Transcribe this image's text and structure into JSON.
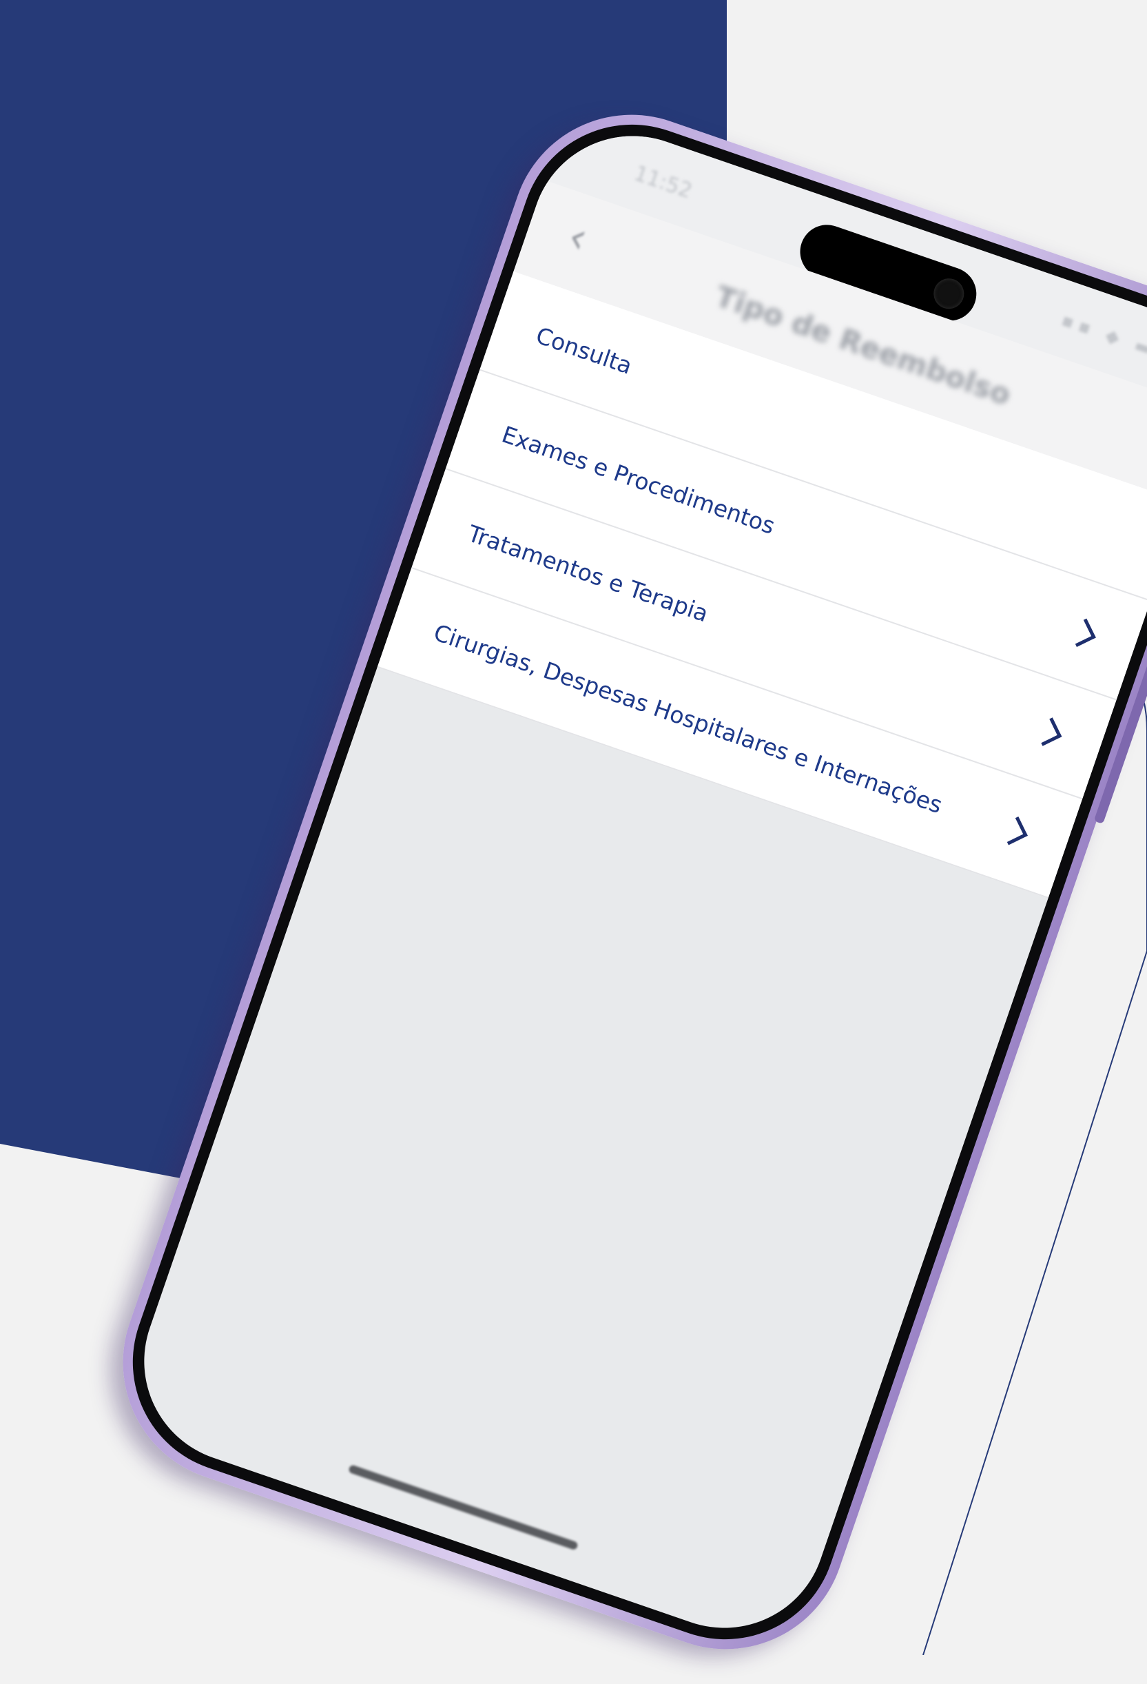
{
  "screen": {
    "status_time": "11:52",
    "status_icons": "▪▪ ◆ ▬",
    "nav": {
      "back_icon": "‹",
      "title": "Tipo de Reembolso",
      "close_icon": "×"
    },
    "menu_items": [
      {
        "label": "Consulta",
        "has_chevron": false
      },
      {
        "label": "Exames e Procedimentos",
        "has_chevron": true
      },
      {
        "label": "Tratamentos e Terapia",
        "has_chevron": true
      },
      {
        "label": "Cirurgias, Despesas Hospitalares e Internações",
        "has_chevron": true
      }
    ]
  },
  "colors": {
    "background_navy": "#263a78",
    "background_light": "#f2f2f2",
    "phone_frame": "#c9b8ea",
    "item_text": "#1e3a8a",
    "chevron": "#1e2f6e",
    "screen_empty": "#e8eaec"
  },
  "icons": {
    "chevron": "chevron-right-icon",
    "back": "back-arrow-icon",
    "close": "close-icon"
  }
}
